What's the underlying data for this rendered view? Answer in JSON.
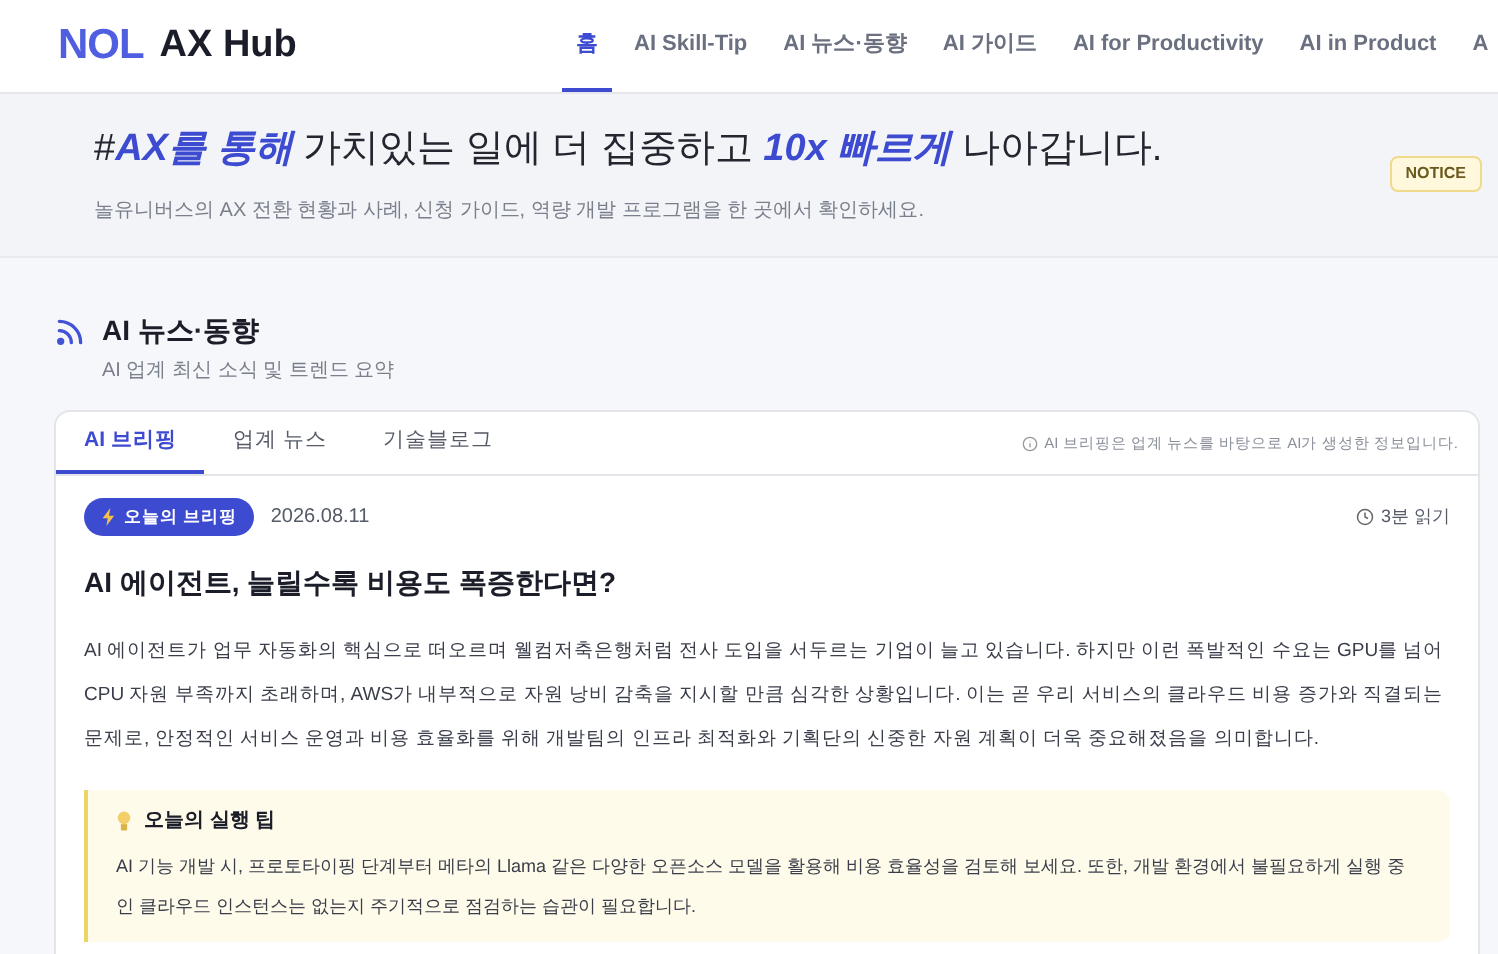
{
  "header": {
    "logo_mark": "NOL",
    "logo_text": "AX Hub",
    "nav": [
      {
        "label": "홈",
        "selected": true
      },
      {
        "label": "AI Skill-Tip",
        "selected": false
      },
      {
        "label": "AI 뉴스·동향",
        "selected": false
      },
      {
        "label": "AI 가이드",
        "selected": false
      },
      {
        "label": "AI for Productivity",
        "selected": false
      },
      {
        "label": "AI in Product",
        "selected": false
      },
      {
        "label": "A",
        "selected": false
      }
    ]
  },
  "hero": {
    "headline": [
      {
        "text": "#",
        "emphasis": false
      },
      {
        "text": "AX를 통해",
        "emphasis": true
      },
      {
        "text": " 가치있는 일에 더 집중하고 ",
        "emphasis": false
      },
      {
        "text": "10x 빠르게",
        "emphasis": true
      },
      {
        "text": " 나아갑니다.",
        "emphasis": false
      }
    ],
    "subtitle": "놀유니버스의 AX 전환 현황과 사례, 신청 가이드, 역량 개발 프로그램을 한 곳에서 확인하세요.",
    "badge": "NOTICE"
  },
  "section": {
    "title": "AI 뉴스·동향",
    "subtitle": "AI 업계 최신 소식 및 트렌드 요약"
  },
  "tabs": [
    {
      "label": "AI 브리핑",
      "selected": true
    },
    {
      "label": "업계 뉴스",
      "selected": false
    },
    {
      "label": "기술블로그",
      "selected": false
    }
  ],
  "tabs_note": "AI 브리핑은 업계 뉴스를 바탕으로 AI가 생성한 정보입니다.",
  "article": {
    "badge": "오늘의 브리핑",
    "date": "2026.08.11",
    "read_time": "3분 읽기",
    "title": "AI 에이전트, 늘릴수록 비용도 폭증한다면?",
    "body": "AI 에이전트가 업무 자동화의 핵심으로 떠오르며 웰컴저축은행처럼 전사 도입을 서두르는 기업이 늘고 있습니다. 하지만 이런 폭발적인 수요는 GPU를 넘어 CPU 자원 부족까지 초래하며, AWS가 내부적으로 자원 낭비 감축을 지시할 만큼 심각한 상황입니다. 이는 곧 우리 서비스의 클라우드 비용 증가와 직결되는 문제로, 안정적인 서비스 운영과 비용 효율화를 위해 개발팀의 인프라 최적화와 기획단의 신중한 자원 계획이 더욱 중요해졌음을 의미합니다.",
    "tip_title": "오늘의 실행 팁",
    "tip_body": "AI 기능 개발 시, 프로토타이핑 단계부터 메타의 Llama 같은 다양한 오픈소스 모델을 활용해 비용 효율성을 검토해 보세요. 또한, 개발 환경에서 불필요하게 실행 중인 클라우드 인스턴스는 없는지 주기적으로 점검하는 습관이 필요합니다."
  }
}
